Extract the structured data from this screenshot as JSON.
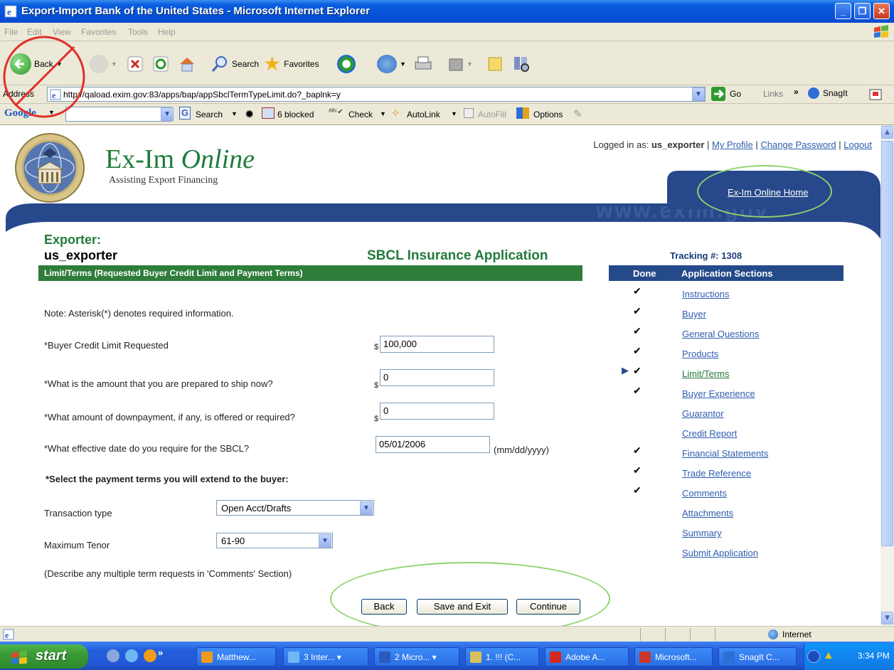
{
  "window": {
    "title": "Export-Import Bank of the United States - Microsoft Internet Explorer"
  },
  "menu": [
    "File",
    "Edit",
    "View",
    "Favorites",
    "Tools",
    "Help"
  ],
  "toolbar": {
    "back": "Back",
    "search": "Search",
    "favorites": "Favorites"
  },
  "address": {
    "label": "Address",
    "url": "http://qaload.exim.gov:83/apps/bap/appSbclTermTypeLimit.do?_baplnk=y",
    "go": "Go",
    "links": "Links",
    "snagit": "SnagIt"
  },
  "google": {
    "logo": "Google",
    "search": "Search",
    "blocked": "6 blocked",
    "check": "Check",
    "autolink": "AutoLink",
    "autofill": "AutoFill",
    "options": "Options"
  },
  "site": {
    "brand_a": "Ex-Im ",
    "brand_b": "Online",
    "tagline": "Assisting Export Financing",
    "logged_in_label": "Logged in as: ",
    "user": "us_exporter",
    "my_profile": "My Profile",
    "change_password": "Change Password",
    "logout": "Logout",
    "home_link": "Ex-Im Online Home",
    "watermark": "www.exim.gov"
  },
  "form": {
    "exporter_label": "Exporter:",
    "exporter_name": "us_exporter",
    "app_title": "SBCL Insurance Application",
    "section_title": "Limit/Terms (Requested Buyer Credit Limit and Payment Terms)",
    "note": "Note: Asterisk(*) denotes required information.",
    "q1": "*Buyer Credit Limit Requested",
    "q1_value": "100,000",
    "q2": "*What is the amount that you are prepared to ship now?",
    "q2_value": "0",
    "q3": "*What amount of downpayment, if any, is offered or required?",
    "q3_value": "0",
    "q4": "*What effective date do you require for the SBCL?",
    "q4_value": "05/01/2006",
    "q4_hint": "(mm/dd/yyyy)",
    "currency": "$",
    "terms_heading": "*Select the payment terms you will extend to the buyer:",
    "transaction_label": "Transaction type",
    "transaction_value": "Open Acct/Drafts",
    "tenor_label": "Maximum Tenor",
    "tenor_value": "61-90",
    "comment_note": "(Describe any multiple term requests in 'Comments' Section)",
    "back": "Back",
    "save_exit": "Save and Exit",
    "continue": "Continue"
  },
  "sidebar": {
    "tracking": "Tracking #: 1308",
    "done_header": "Done",
    "sections_header": "Application Sections",
    "items": [
      {
        "label": "Instructions",
        "done": true
      },
      {
        "label": "Buyer",
        "done": true
      },
      {
        "label": "General Questions",
        "done": true
      },
      {
        "label": "Products",
        "done": true
      },
      {
        "label": "Limit/Terms",
        "done": true,
        "current": true
      },
      {
        "label": "Buyer Experience",
        "done": true
      },
      {
        "label": "Guarantor",
        "done": false
      },
      {
        "label": "Credit Report",
        "done": false
      },
      {
        "label": "Financial Statements",
        "done": true
      },
      {
        "label": "Trade Reference",
        "done": true
      },
      {
        "label": "Comments",
        "done": true
      },
      {
        "label": "Attachments",
        "done": false
      },
      {
        "label": "Summary",
        "done": false
      },
      {
        "label": "Submit Application",
        "done": false
      }
    ]
  },
  "status": {
    "zone": "Internet"
  },
  "taskbar": {
    "start": "start",
    "tasks": [
      "Matthew...",
      "3 Inter...",
      "2 Micro...",
      "1. !!! (C...",
      "Adobe A...",
      "Microsoft...",
      "SnagIt C..."
    ],
    "clock": "3:34 PM"
  },
  "colors": {
    "accent_green": "#237a3c",
    "nav_blue": "#254a8a",
    "link_blue": "#2f5db0",
    "annotation_green": "#8fd46d",
    "annotation_red": "#e0302a"
  }
}
